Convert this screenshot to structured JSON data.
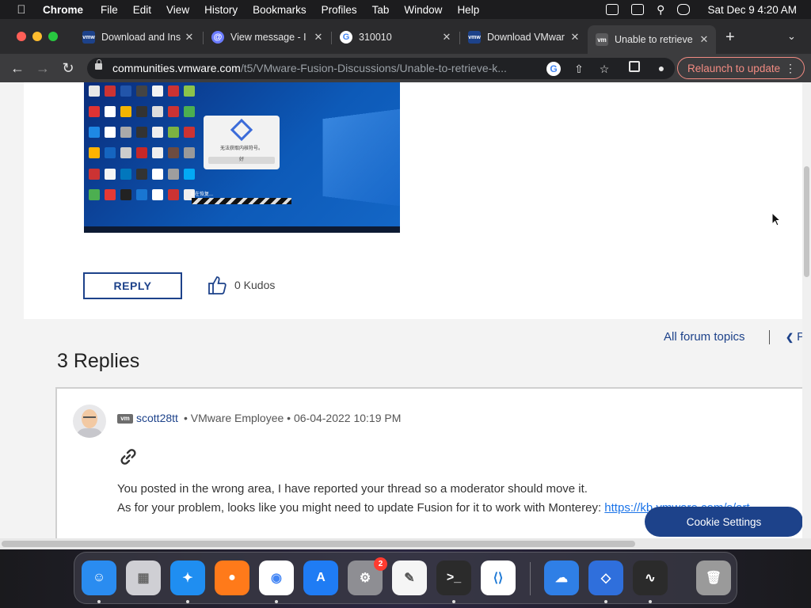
{
  "menubar": {
    "app": "Chrome",
    "items": [
      "File",
      "Edit",
      "View",
      "History",
      "Bookmarks",
      "Profiles",
      "Tab",
      "Window",
      "Help"
    ],
    "clock": "Sat Dec 9  4:20 AM"
  },
  "tabs": [
    {
      "title": "Download and Ins",
      "favicon": "vmw",
      "color": "#1d428a"
    },
    {
      "title": "View message - I",
      "favicon": "@",
      "color": "#3c3c3e"
    },
    {
      "title": "310010",
      "favicon": "G",
      "color": "#ffffff"
    },
    {
      "title": "Download VMwar",
      "favicon": "vmw",
      "color": "#1d428a"
    },
    {
      "title": "Unable to retrieve",
      "favicon": "vm",
      "color": "#555555"
    }
  ],
  "toolbar": {
    "url_host": "communities.vmware.com",
    "url_path": "/t5/VMware-Fusion-Discussions/Unable-to-retrieve-k...",
    "relaunch_label": "Relaunch to update"
  },
  "screenshot": {
    "dialog_message": "无法获取内核符号。",
    "dialog_button": "好",
    "start_message": "正在恢复..."
  },
  "post": {
    "reply_label": "REPLY",
    "kudos": "0 Kudos"
  },
  "nav": {
    "all_topics": "All forum topics",
    "previous": "P"
  },
  "replies": {
    "heading": "3 Replies",
    "items": [
      {
        "badge": "vm",
        "author": "scott28tt",
        "meta": "• VMware Employee • 06-04-2022 10:19 PM",
        "line1": "You posted in the wrong area, I have reported your thread so a moderator should move it.",
        "line2": "As for your problem, looks like you might need to update Fusion for it to work with Monterey:",
        "link": "https://kb.vmware.com/s/art"
      }
    ]
  },
  "cookie_label": "Cookie Settings",
  "dock": [
    {
      "name": "Finder",
      "color": "#2a8cf0"
    },
    {
      "name": "Launchpad",
      "color": "#cfcfd4"
    },
    {
      "name": "Safari",
      "color": "#1f8ef1"
    },
    {
      "name": "Firefox",
      "color": "#ff7a1a"
    },
    {
      "name": "Chrome",
      "color": "#ffffff"
    },
    {
      "name": "App Store",
      "color": "#1f7cf4"
    },
    {
      "name": "System Preferences",
      "color": "#8e8e93",
      "badge": "2"
    },
    {
      "name": "TextEdit",
      "color": "#f5f5f5"
    },
    {
      "name": "Terminal",
      "color": "#2b2b2b"
    },
    {
      "name": "Visual Studio Code",
      "color": "#ffffff"
    },
    {
      "name": "Weather",
      "color": "#2f7fe6"
    },
    {
      "name": "VMware Fusion",
      "color": "#2f6fdc"
    },
    {
      "name": "Activity Monitor",
      "color": "#2b2b2b"
    },
    {
      "name": "Trash",
      "color": "#9a9a9a"
    }
  ]
}
